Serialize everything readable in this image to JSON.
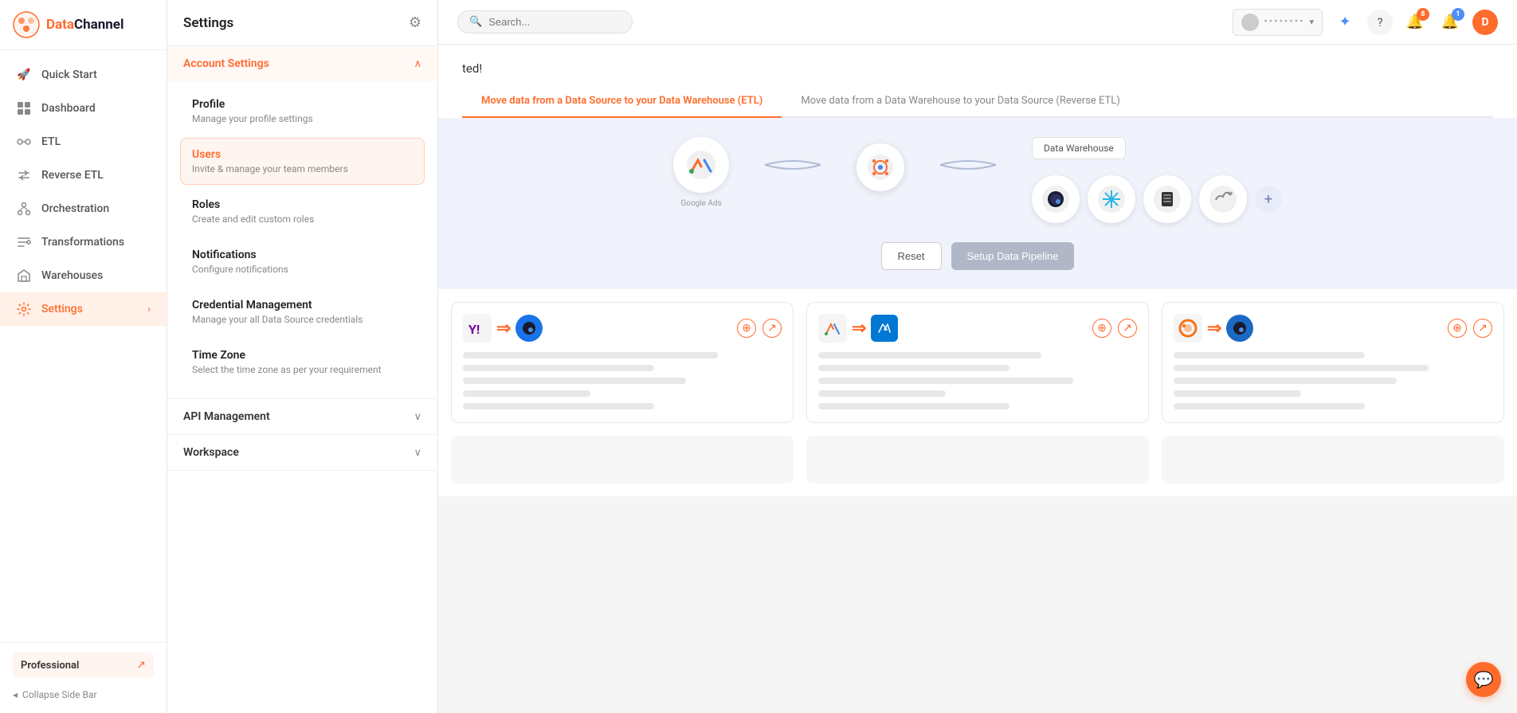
{
  "brand": {
    "name_part1": "Data",
    "name_part2": "Channel"
  },
  "sidebar": {
    "items": [
      {
        "id": "quickstart",
        "label": "Quick Start",
        "icon": "🚀"
      },
      {
        "id": "dashboard",
        "label": "Dashboard",
        "icon": "⊞"
      },
      {
        "id": "etl",
        "label": "ETL",
        "icon": "↔"
      },
      {
        "id": "reverse-etl",
        "label": "Reverse ETL",
        "icon": "↩"
      },
      {
        "id": "orchestration",
        "label": "Orchestration",
        "icon": "⚡"
      },
      {
        "id": "transformations",
        "label": "Transformations",
        "icon": "⟳"
      },
      {
        "id": "warehouses",
        "label": "Warehouses",
        "icon": "⬡"
      },
      {
        "id": "settings",
        "label": "Settings",
        "icon": "⚙",
        "active": true,
        "hasChevron": true
      }
    ],
    "professional_label": "Professional",
    "collapse_label": "Collapse Side Bar"
  },
  "settings_panel": {
    "title": "Settings",
    "account_settings_label": "Account Settings",
    "api_management_label": "API Management",
    "workspace_label": "Workspace",
    "items": [
      {
        "id": "profile",
        "title": "Profile",
        "desc": "Manage your profile settings",
        "active": false
      },
      {
        "id": "users",
        "title": "Users",
        "desc": "Invite & manage your team members",
        "active": true
      },
      {
        "id": "roles",
        "title": "Roles",
        "desc": "Create and edit custom roles",
        "active": false
      },
      {
        "id": "notifications",
        "title": "Notifications",
        "desc": "Configure notifications",
        "active": false
      },
      {
        "id": "credential-management",
        "title": "Credential Management",
        "desc": "Manage your all Data Source credentials",
        "active": false
      },
      {
        "id": "time-zone",
        "title": "Time Zone",
        "desc": "Select the time zone as per your requirement",
        "active": false
      }
    ]
  },
  "topbar": {
    "search_placeholder": "Search...",
    "workspace_name": "••••••••",
    "notification_count": "8",
    "alert_count": "1",
    "user_initial": "D"
  },
  "main": {
    "banner_text": "ted!",
    "tabs": [
      {
        "label": "Move data from a Data Source to your Data Warehouse (ETL)",
        "active": true
      },
      {
        "label": "Move data from a Data Warehouse to your Data Source (Reverse ETL)",
        "active": false
      }
    ],
    "pipeline": {
      "dw_label": "Data Warehouse",
      "reset_btn": "Reset",
      "setup_btn": "Setup Data Pipeline"
    },
    "cards": [
      {
        "source_icon": "Y",
        "source_color": "#7B0099",
        "dest_color": "#1a73e8",
        "dest_icon": "Q"
      },
      {
        "source_icon": "A",
        "source_color": "#4285F4",
        "dest_color": "#1a73e8",
        "dest_icon": "▣"
      },
      {
        "source_icon": "O",
        "source_color": "#F97316",
        "dest_color": "#1a69c4",
        "dest_icon": "Q"
      }
    ]
  },
  "chat": {
    "icon": "💬"
  }
}
